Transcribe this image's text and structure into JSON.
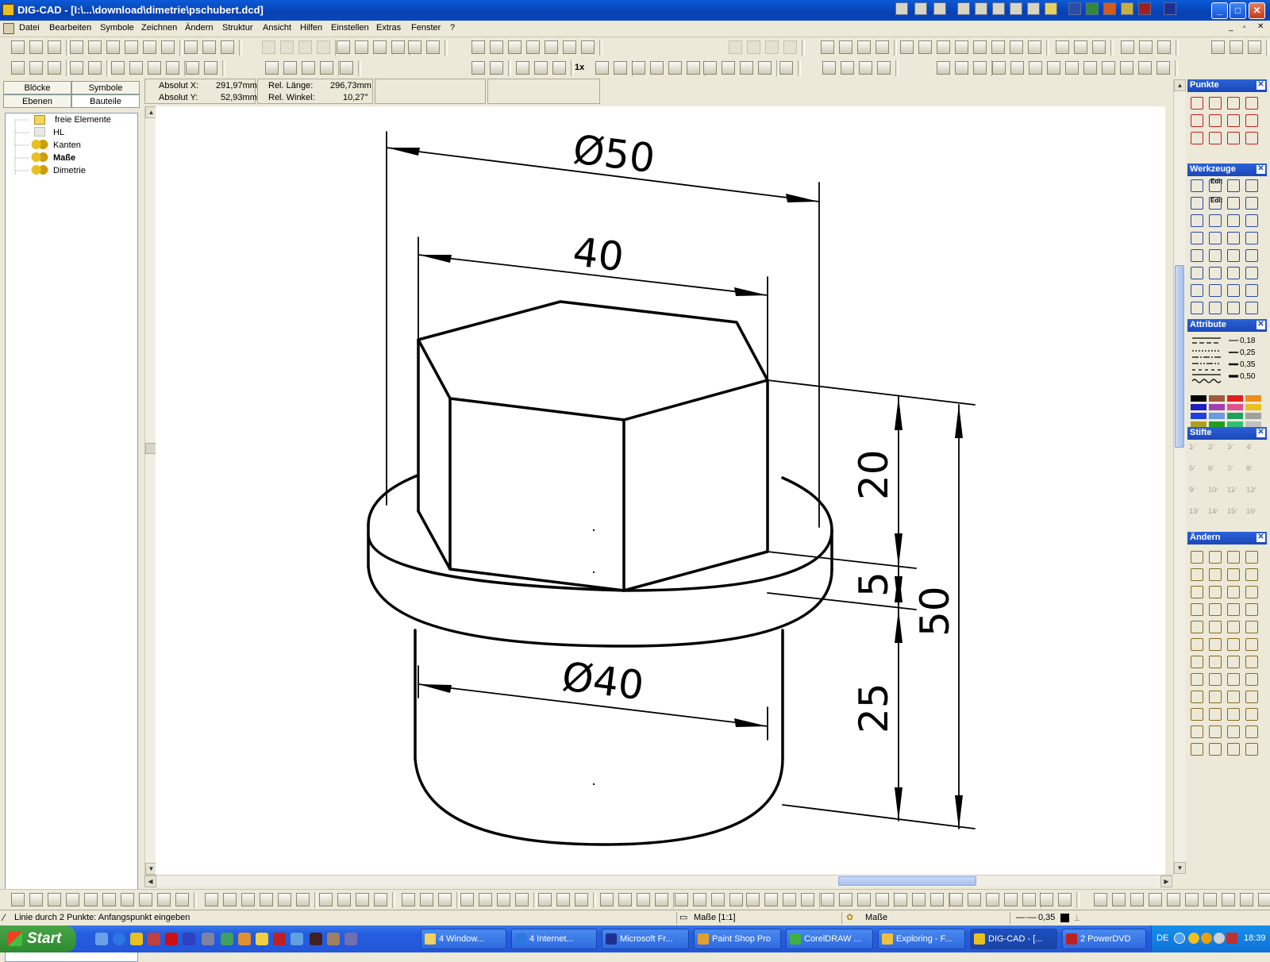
{
  "window": {
    "title": "DIG-CAD - [I:\\...\\download\\dimetrie\\pschubert.dcd]"
  },
  "menu": [
    "Datei",
    "Bearbeiten",
    "Symbole",
    "Zeichnen",
    "Ändern",
    "Struktur",
    "Ansicht",
    "Hilfen",
    "Einstellen",
    "Extras",
    "Fenster",
    "?"
  ],
  "left_tabs": {
    "row1": [
      "Blöcke",
      "Symbole"
    ],
    "row2": [
      "Ebenen",
      "Bauteile"
    ]
  },
  "tree": [
    {
      "label": "freie Elemente",
      "bold": false
    },
    {
      "label": "HL",
      "bold": false
    },
    {
      "label": "Kanten",
      "bold": false
    },
    {
      "label": "Maße",
      "bold": true
    },
    {
      "label": "Dimetrie",
      "bold": false
    }
  ],
  "coords": {
    "abs_x_label": "Absolut X:",
    "abs_x_value": "291,97mm",
    "abs_y_label": "Absolut Y:",
    "abs_y_value": "52,93mm",
    "rel_len_label": "Rel. Länge:",
    "rel_len_value": "296,73mm",
    "rel_angle_label": "Rel. Winkel:",
    "rel_angle_value": "10,27°"
  },
  "drawing": {
    "dim_d50": "Ø50",
    "dim_40": "40",
    "dim_d40": "Ø40",
    "dim_20": "20",
    "dim_5": "5",
    "dim_50": "50",
    "dim_25": "25"
  },
  "zoom_toolbar": {
    "one_x": "1x"
  },
  "panels": {
    "punkte": "Punkte",
    "werkzeuge": "Werkzeuge",
    "attribute": "Attribute",
    "stifte": "Stifte",
    "aendern": "Ändern",
    "edit1": "Edit",
    "edit2": "Edit"
  },
  "line_widths": [
    "0,18",
    "0,25",
    "0,35",
    "0,50"
  ],
  "pen_numbers": [
    "1",
    "2",
    "3",
    "4",
    "5",
    "6",
    "7",
    "8",
    "9",
    "10",
    "11",
    "12",
    "13",
    "14",
    "15",
    "16"
  ],
  "attribute_colors": [
    "#000000",
    "#a05a3c",
    "#e02020",
    "#f08c1e",
    "#2020c0",
    "#a040b0",
    "#e05090",
    "#e8c020",
    "#2040e0",
    "#6a9ae0",
    "#20a060",
    "#a0a0a0",
    "#b0a020",
    "#20a020",
    "#30c070",
    "#c0c0c0"
  ],
  "status": {
    "hint": "Linie durch 2 Punkte: Anfangspunkt eingeben",
    "layer": "Maße [1:1]",
    "part": "Maße",
    "pen": "0,35"
  },
  "taskbar": {
    "start": "Start",
    "tasks": [
      "4 Window...",
      "4 Internet...",
      "Microsoft Fr...",
      "Paint Shop Pro",
      "CorelDRAW ...",
      "Exploring - F...",
      "DIG-CAD - [...",
      "2 PowerDVD"
    ],
    "lang": "DE",
    "clock": "18:39"
  }
}
